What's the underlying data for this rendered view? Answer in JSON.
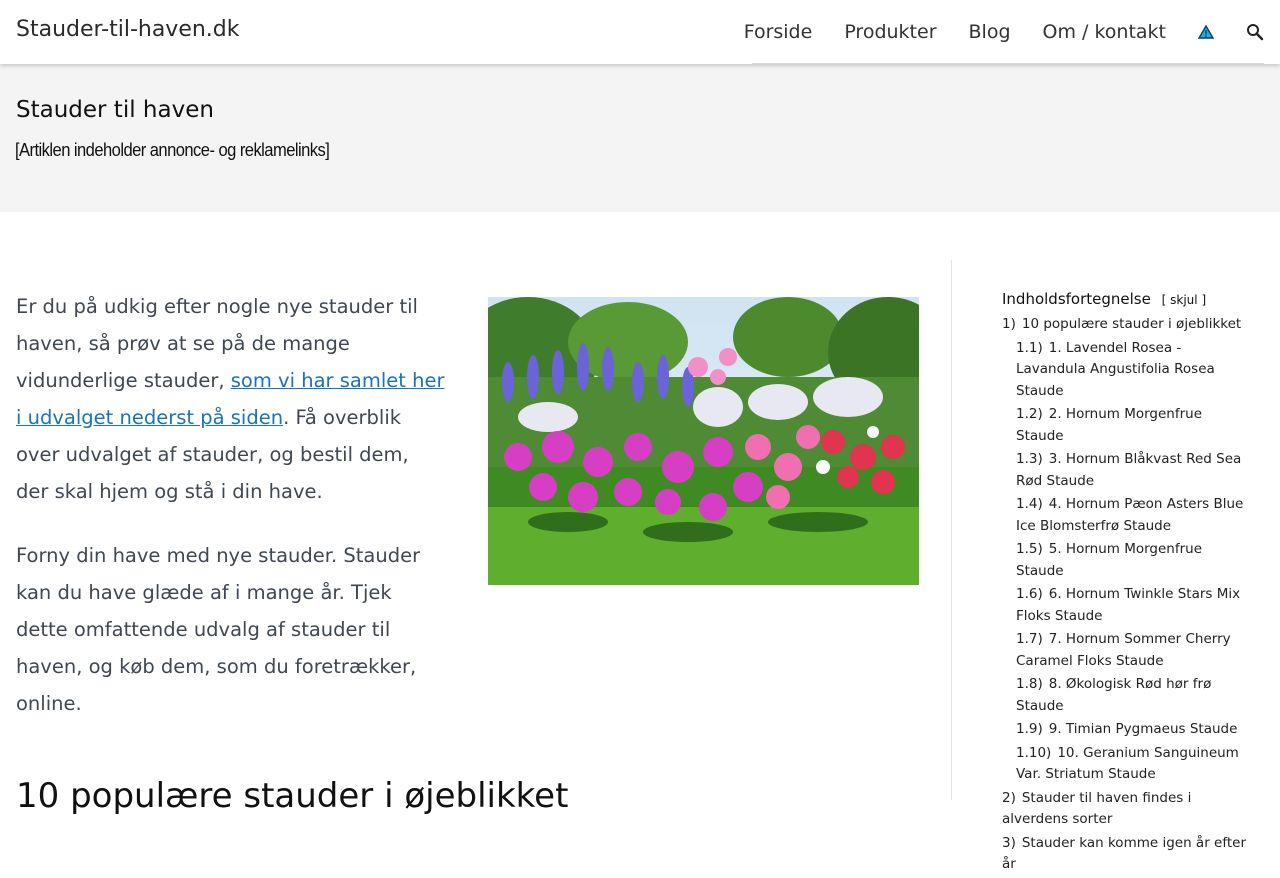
{
  "header": {
    "site_title": "Stauder-til-haven.dk",
    "nav": [
      "Forside",
      "Produkter",
      "Blog",
      "Om / kontakt"
    ],
    "icons": [
      "warning-icon",
      "search-icon"
    ]
  },
  "hero": {
    "title": "Stauder til haven",
    "notice": "[Artiklen indeholder annonce- og reklamelinks]"
  },
  "content": {
    "p1_before": "Er du på udkig efter nogle nye stauder til haven, så prøv at se på de mange vidunderlige stauder, ",
    "p1_link": "som vi har samlet her i udvalget nederst på siden",
    "p1_after": ". Få overblik over udvalget af stauder, og bestil dem, der skal hjem og stå i din have.",
    "p2": "Forny din have med nye stauder. Stauder kan du have glæde af i mange år. Tjek dette omfattende udvalg af stauder til haven, og køb dem, som du foretrækker, online.",
    "section_title": "10 populære stauder i øjeblikket"
  },
  "toc": {
    "title": "Indholdsfortegnelse",
    "toggle_open": "[",
    "toggle_label": "skjul",
    "toggle_close": "]",
    "items": [
      {
        "num": "1)",
        "label": "10 populære stauder i øjeblikket",
        "sub": false
      },
      {
        "num": "1.1)",
        "label": "1. Lavendel Rosea - Lavandula Angustifolia Rosea Staude",
        "sub": true
      },
      {
        "num": "1.2)",
        "label": "2. Hornum Morgenfrue Staude",
        "sub": true
      },
      {
        "num": "1.3)",
        "label": "3. Hornum Blåkvast Red Sea Rød Staude",
        "sub": true
      },
      {
        "num": "1.4)",
        "label": "4. Hornum Pæon Asters Blue Ice Blomsterfrø Staude",
        "sub": true
      },
      {
        "num": "1.5)",
        "label": "5. Hornum Morgenfrue Staude",
        "sub": true
      },
      {
        "num": "1.6)",
        "label": "6. Hornum Twinkle Stars Mix Floks Staude",
        "sub": true
      },
      {
        "num": "1.7)",
        "label": "7. Hornum Sommer Cherry Caramel Floks Staude",
        "sub": true
      },
      {
        "num": "1.8)",
        "label": "8. Økologisk Rød hør frø Staude",
        "sub": true
      },
      {
        "num": "1.9)",
        "label": "9. Timian Pygmaeus Staude",
        "sub": true
      },
      {
        "num": "1.10)",
        "label": "10. Geranium Sanguineum Var. Striatum Staude",
        "sub": true
      },
      {
        "num": "2)",
        "label": "Stauder til haven findes i alverdens sorter",
        "sub": false
      },
      {
        "num": "3)",
        "label": "Stauder kan komme igen år efter år",
        "sub": false
      }
    ]
  }
}
